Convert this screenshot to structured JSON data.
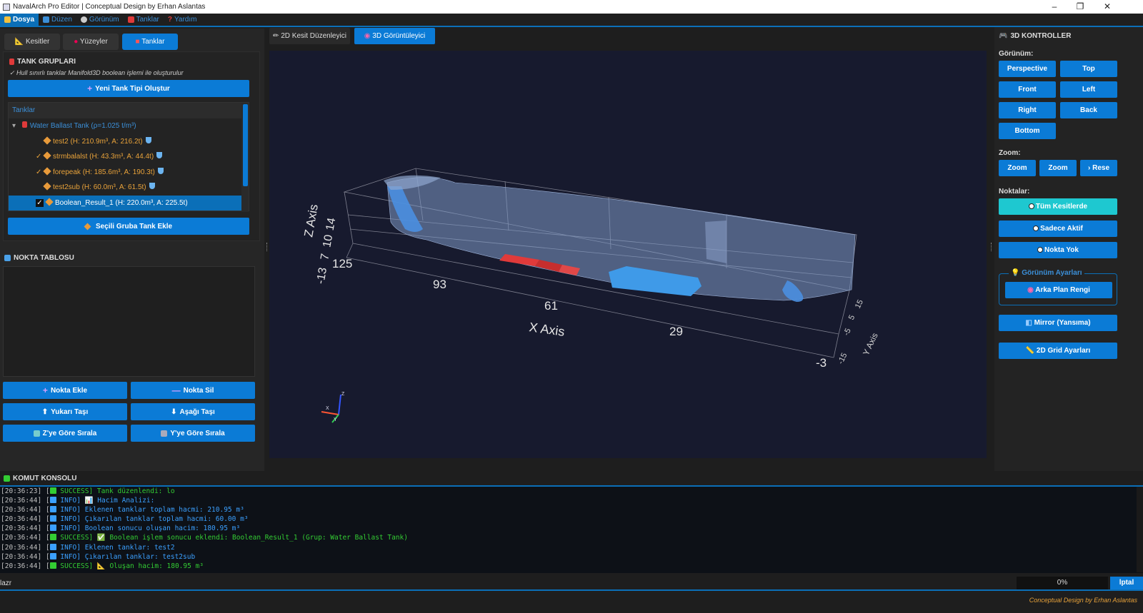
{
  "window": {
    "title": "NavalArch Pro Editor | Conceptual Design by Erhan Aslantas",
    "min": "–",
    "max": "❐",
    "close": "✕"
  },
  "menu": [
    {
      "label": "Dosya",
      "icon": "folder-icon"
    },
    {
      "label": "Düzen",
      "icon": "edit-icon"
    },
    {
      "label": "Görünüm",
      "icon": "view-icon"
    },
    {
      "label": "Tanklar",
      "icon": "tank-icon"
    },
    {
      "label": "Yardım",
      "icon": "help-icon"
    }
  ],
  "left_tabs": [
    "Kesitler",
    "Yüzeyler",
    "Tanklar"
  ],
  "tank_groups": {
    "title": "TANK GRUPLARI",
    "note": "✓ Hull sınırlı tanklar Manifold3D boolean işlemi ile oluşturulur",
    "new_button": "Yeni Tank Tipi Oluştur",
    "tree_header": "Tanklar",
    "group": "Water Ballast Tank (ρ=1.025 t/m³)",
    "items": [
      {
        "label": "test2 (H: 210.9m³, A: 216.2t)",
        "check": "",
        "selected": false
      },
      {
        "label": "strmbalalst (H: 43.3m³, A: 44.4t)",
        "check": "✓",
        "selected": false
      },
      {
        "label": "forepeak (H: 185.6m³, A: 190.3t)",
        "check": "✓",
        "selected": false
      },
      {
        "label": "test2sub (H: 60.0m³, A: 61.5t)",
        "check": "",
        "selected": false
      },
      {
        "label": "Boolean_Result_1 (H: 220.0m³, A: 225.5t)",
        "check": "✓",
        "selected": true
      }
    ],
    "add_button": "Seçili Gruba Tank Ekle"
  },
  "point_table": {
    "title": "NOKTA TABLOSU",
    "buttons": [
      "Nokta Ekle",
      "Nokta Sil",
      "Yukarı Taşı",
      "Aşağı Taşı",
      "Z'ye Göre Sırala",
      "Y'ye Göre Sırala"
    ]
  },
  "center_tabs": [
    "2D Kesit Düzenleyici",
    "3D Görüntüleyici"
  ],
  "viewport": {
    "x_axis_label": "X Axis",
    "z_axis_label": "Z Axis",
    "y_axis_label": "Y Axis",
    "x_ticks": [
      "125",
      "93",
      "61",
      "29",
      "-3"
    ],
    "z_ticks": [
      "-13",
      "7",
      "10",
      "14"
    ],
    "y_ticks": [
      "-15",
      "-5",
      "5",
      "15"
    ],
    "triad": {
      "x": "X",
      "y": "Y",
      "z": "Z"
    }
  },
  "right_panel": {
    "title": "3D KONTROLLER",
    "view_label": "Görünüm:",
    "views": [
      "Perspective",
      "Top",
      "Front",
      "Left",
      "Right",
      "Back",
      "Bottom"
    ],
    "zoom_label": "Zoom:",
    "zooms": [
      "Zoom",
      "Zoom",
      "› Rese"
    ],
    "points_label": "Noktalar:",
    "points": [
      "Tüm Kesitlerde",
      "Sadece Aktif",
      "Nokta Yok"
    ],
    "view_settings_title": "Görünüm Ayarları",
    "bg_button": "Arka Plan Rengi",
    "mirror_button": "Mirror (Yansıma)",
    "grid_button": "2D Grid Ayarları"
  },
  "console": {
    "title": "KOMUT KONSOLU",
    "lines": [
      {
        "ts": "[20:36:23]",
        "type": "SUCCESS",
        "text": "Tank düzenlendi: lo"
      },
      {
        "ts": "[20:36:44]",
        "type": "INFO",
        "text": "📊 Hacim Analizi:"
      },
      {
        "ts": "[20:36:44]",
        "type": "INFO",
        "text": "Eklenen tanklar toplam hacmi: 210.95 m³"
      },
      {
        "ts": "[20:36:44]",
        "type": "INFO",
        "text": "Çıkarılan tanklar toplam hacmi: 60.00 m³"
      },
      {
        "ts": "[20:36:44]",
        "type": "INFO",
        "text": "Boolean sonucu oluşan hacim: 180.95 m³"
      },
      {
        "ts": "[20:36:44]",
        "type": "SUCCESS",
        "text": "✅ Boolean işlem sonucu eklendi: Boolean_Result_1 (Grup: Water Ballast Tank)"
      },
      {
        "ts": "[20:36:44]",
        "type": "INFO",
        "text": "Eklenen tanklar: test2"
      },
      {
        "ts": "[20:36:44]",
        "type": "INFO",
        "text": "Çıkarılan tanklar: test2sub"
      },
      {
        "ts": "[20:36:44]",
        "type": "SUCCESS",
        "text": "📐 Oluşan hacim: 180.95 m³"
      }
    ]
  },
  "status": {
    "left": "lazr",
    "progress": "0%",
    "progress_value": 0,
    "button": "lptal"
  },
  "footer": "Conceptual Design by Erhan Aslantas",
  "colors": {
    "accent": "#0b7bd6",
    "success": "#33cc33",
    "info": "#3ba0ff",
    "tank_red": "#e03a3a",
    "tank_blue": "#3f9ae8"
  }
}
